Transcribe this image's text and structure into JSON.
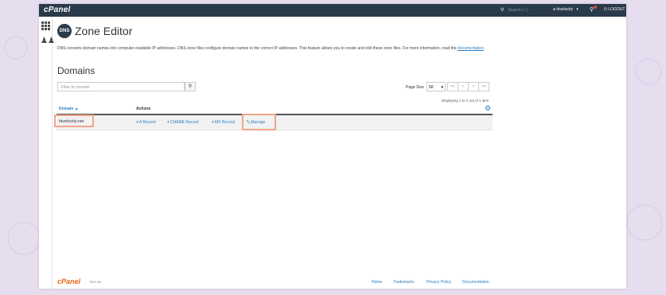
{
  "topbar": {
    "logo": "cPanel",
    "search_placeholder": "Search ( / )",
    "username": "hivelocity",
    "logout_label": "LOGOUT"
  },
  "page": {
    "badge": "DNS",
    "title": "Zone Editor",
    "description_pre": "DNS converts domain names into computer-readable IP addresses. DNS zone files configure domain names to the correct IP addresses. This feature allows you to create and edit these zone files. For more information, read the",
    "doc_link": "documentation",
    "description_post": ".",
    "section_title": "Domains"
  },
  "controls": {
    "filter_placeholder": "Filter by domain",
    "page_size_label": "Page Size",
    "page_size_value": "50",
    "pager": [
      "<<",
      "<",
      ">",
      ">>"
    ],
    "displaying": "Displaying 1 to 1 out of 1 item"
  },
  "table": {
    "col_domain": "Domain ▲",
    "col_actions": "Actions",
    "rows": [
      {
        "domain": "hivelocity.net",
        "a_record": "A Record",
        "cname_record": "CNAME Record",
        "mx_record": "MX Record",
        "manage": "Manage"
      }
    ]
  },
  "footer": {
    "logo": "cPanel",
    "version": "78.0.15",
    "links": [
      "Home",
      "Trademarks",
      "Privacy Policy",
      "Documentation"
    ]
  },
  "colors": {
    "topbar": "#293a4a",
    "link": "#2b7fc1",
    "highlight": "#f0a58a",
    "footer_logo": "#e8681a"
  }
}
